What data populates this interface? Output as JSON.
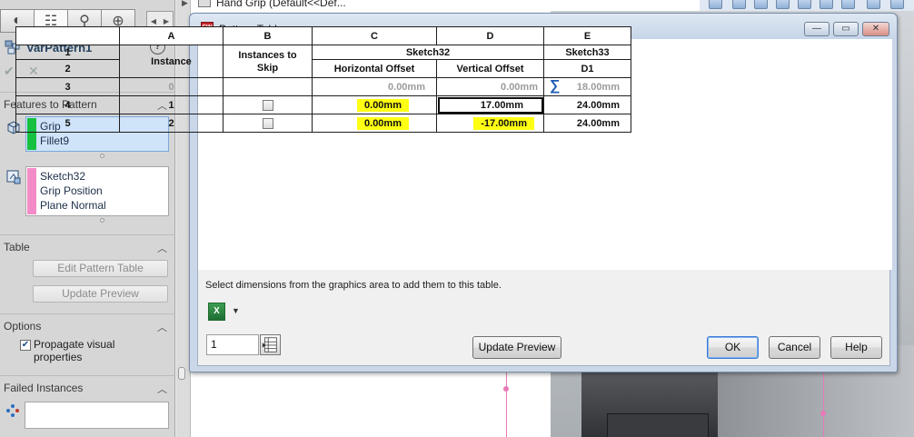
{
  "property_manager": {
    "feature_name": "VarPattern1",
    "help_glyph": "?",
    "ok_glyph": "✔",
    "cancel_glyph": "✕",
    "tab_glyphs": [
      "◐",
      "☷",
      "⚲",
      "⊕"
    ],
    "sections": {
      "features": {
        "title": "Features to Pattern",
        "items": [
          "Grip",
          "Fillet9"
        ],
        "bar_color": "#16c040"
      },
      "references": {
        "items": [
          "Sketch32",
          "Grip Position",
          "Plane Normal"
        ],
        "bar_color": "#f38cc6"
      },
      "table": {
        "title": "Table",
        "edit_label": "Edit Pattern Table",
        "update_label": "Update Preview"
      },
      "options": {
        "title": "Options",
        "propagate_label": "Propagate visual properties",
        "propagate_checked": true
      },
      "failed": {
        "title": "Failed Instances"
      }
    }
  },
  "background": {
    "tree_label": "Hand Grip  (Default<<Def..."
  },
  "dialog": {
    "title": "Pattern Table",
    "icon_label": "SW",
    "columns": [
      "A",
      "B",
      "C",
      "D",
      "E"
    ],
    "header_row1_num": "1",
    "header_row2_num": "2",
    "col_a_header": "Instance",
    "col_b_header": "Instances to Skip",
    "sketch32": "Sketch32",
    "sketch33": "Sketch33",
    "col_c_header": "Horizontal Offset",
    "col_d_header": "Vertical Offset",
    "col_e_header": "D1",
    "rows": [
      {
        "num": "3",
        "instance": "0",
        "h": "0.00mm",
        "v": "0.00mm",
        "d1": "18.00mm",
        "seed": true
      },
      {
        "num": "4",
        "instance": "1",
        "h": "0.00mm",
        "v": "17.00mm",
        "d1": "24.00mm",
        "seed": false
      },
      {
        "num": "5",
        "instance": "2",
        "h": "0.00mm",
        "v": "-17.00mm",
        "d1": "24.00mm",
        "seed": false
      }
    ],
    "hint": "Select dimensions from the graphics area to add them to this table.",
    "instance_count": "1",
    "update_preview": "Update Preview",
    "ok": "OK",
    "cancel": "Cancel",
    "help": "Help",
    "highlight_color": "#ffff14"
  }
}
